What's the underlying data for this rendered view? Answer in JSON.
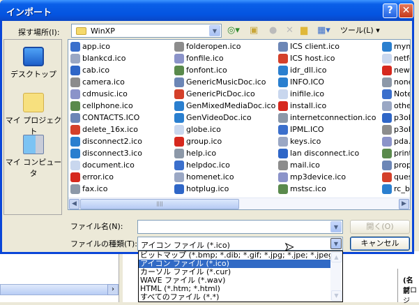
{
  "window": {
    "title": "インポート",
    "help_label": "?",
    "close_label": "✕"
  },
  "look_in": {
    "label": "探す場所(I):",
    "value": "WinXP",
    "tools_label": "ツール(L)"
  },
  "places": [
    {
      "label": "デスクトップ",
      "icon": "desktop-icon"
    },
    {
      "label": "マイ プロジェクト",
      "icon": "folder-icon"
    },
    {
      "label": "マイ コンピュータ",
      "icon": "computer-icon"
    }
  ],
  "files": {
    "col1": [
      "app.ico",
      "blankcd.ico",
      "cab.ico",
      "camera.ico",
      "cdmusic.ico",
      "cellphone.ico",
      "CONTACTS.ICO",
      "delete_16x.ico",
      "disconnect2.ico",
      "disconnect3.ico",
      "document.ico",
      "error.ico",
      "fax.ico"
    ],
    "col2": [
      "folderopen.ico",
      "fonfile.ico",
      "fonfont.ico",
      "GenericMusicDoc.ico",
      "GenericPicDoc.ico",
      "GenMixedMediaDoc.ico",
      "GenVideoDoc.ico",
      "globe.ico",
      "group.ico",
      "help.ico",
      "helpdoc.ico",
      "homenet.ico",
      "hotplug.ico"
    ],
    "col3": [
      "ICS client.ico",
      "ICS host.ico",
      "idr_dll.ico",
      "INFO.ICO",
      "inifile.ico",
      "install.ico",
      "internetconnection.ico",
      "IPML.ICO",
      "keys.ico",
      "lan disconnect.ico",
      "mail.ico",
      "mp3device.ico",
      "mstsc.ico"
    ],
    "col4": [
      "myne",
      "netfc",
      "newf",
      "none",
      "Note",
      "other",
      "p3oE",
      "p3oE",
      "pda.i",
      "print",
      "prope",
      "ques",
      "rc_bi"
    ]
  },
  "file_name": {
    "label": "ファイル名(N):",
    "value": "",
    "open_label": "開く(O)"
  },
  "file_type": {
    "label": "ファイルの種類(T):",
    "value": "アイコン ファイル (*.ico)",
    "cancel_label": "キャンセル",
    "options": [
      "ビットマップ (*.bmp; *.dib; *.gif; *.jpg; *.jpe; *.jpeg)",
      "アイコン ファイル (*.ico)",
      "カーソル ファイル (*.cur)",
      "WAVE ファイル (*.wav)",
      "HTML (*.htm; *.html)",
      "すべてのファイル (*.*)"
    ],
    "selected_index": 1
  },
  "background": {
    "text1": "(名前",
    "text2": "プロジ"
  },
  "colors": {
    "title_bar": "#0454e0",
    "selection": "#316ac5"
  }
}
